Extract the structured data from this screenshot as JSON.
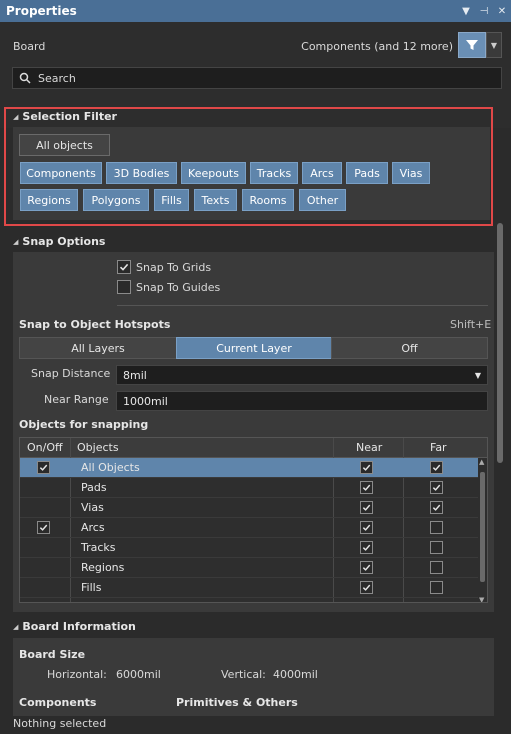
{
  "window": {
    "title": "Properties"
  },
  "header": {
    "board_label": "Board",
    "components_label": "Components (and 12 more)",
    "search_placeholder": "Search"
  },
  "selection_filter": {
    "title": "Selection Filter",
    "all_objects": "All objects",
    "row1": [
      "Components",
      "3D Bodies",
      "Keepouts",
      "Tracks",
      "Arcs",
      "Pads",
      "Vias"
    ],
    "row2": [
      "Regions",
      "Polygons",
      "Fills",
      "Texts",
      "Rooms",
      "Other"
    ]
  },
  "snap_options": {
    "title": "Snap Options",
    "snap_to_grids": "Snap To Grids",
    "snap_to_guides": "Snap To Guides",
    "hotspots_title": "Snap to Object Hotspots",
    "shortcut": "Shift+E",
    "segments": [
      "All Layers",
      "Current Layer",
      "Off"
    ],
    "snap_distance_label": "Snap Distance",
    "snap_distance_value": "8mil",
    "near_range_label": "Near Range",
    "near_range_value": "1000mil",
    "objects_title": "Objects for snapping",
    "columns": [
      "On/Off",
      "Objects",
      "Near",
      "Far"
    ],
    "rows": [
      {
        "name": "All Objects",
        "on": true,
        "near": true,
        "far": true
      },
      {
        "name": "Pads",
        "on": false,
        "near": true,
        "far": true
      },
      {
        "name": "Vias",
        "on": false,
        "near": true,
        "far": true
      },
      {
        "name": "Arcs",
        "on": true,
        "near": true,
        "far": false
      },
      {
        "name": "Tracks",
        "on": false,
        "near": true,
        "far": false
      },
      {
        "name": "Regions",
        "on": false,
        "near": true,
        "far": false
      },
      {
        "name": "Fills",
        "on": false,
        "near": true,
        "far": false
      }
    ]
  },
  "board_information": {
    "title": "Board Information",
    "board_size_label": "Board Size",
    "horizontal_label": "Horizontal:",
    "horizontal_value": "6000mil",
    "vertical_label": "Vertical:",
    "vertical_value": "4000mil",
    "components_label": "Components",
    "primitives_label": "Primitives & Others"
  },
  "status": {
    "text": "Nothing selected"
  },
  "colors": {
    "accent": "#5f85ab",
    "titlebar": "#4a6f96",
    "highlight": "#e04848"
  }
}
